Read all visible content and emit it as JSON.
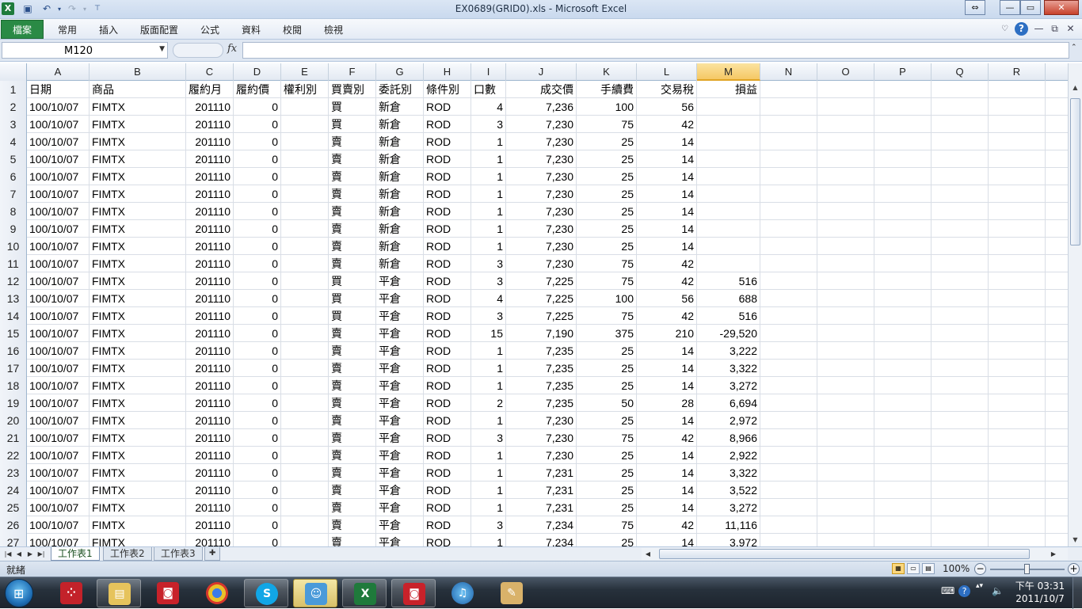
{
  "window": {
    "title": "EX0689(GRID0).xls - Microsoft Excel",
    "app_icon": "X"
  },
  "ribbon": {
    "file_tab": "檔案",
    "tabs": [
      "常用",
      "插入",
      "版面配置",
      "公式",
      "資料",
      "校閱",
      "檢視"
    ]
  },
  "formula_bar": {
    "name_box": "M120",
    "fx": "fx",
    "formula": ""
  },
  "columns": [
    "A",
    "B",
    "C",
    "D",
    "E",
    "F",
    "G",
    "H",
    "I",
    "J",
    "K",
    "L",
    "M",
    "N",
    "O",
    "P",
    "Q",
    "R"
  ],
  "selected_column": "M",
  "header_row": [
    "日期",
    "商品",
    "履約月",
    "履約價",
    "權利別",
    "買賣別",
    "委託別",
    "條件別",
    "口數",
    "成交價",
    "手續費",
    "交易稅",
    "損益"
  ],
  "rows": [
    [
      "2",
      "100/10/07",
      "FIMTX",
      "201110",
      "0",
      "",
      "買",
      "新倉",
      "ROD",
      "4",
      "7,236",
      "100",
      "56",
      ""
    ],
    [
      "3",
      "100/10/07",
      "FIMTX",
      "201110",
      "0",
      "",
      "買",
      "新倉",
      "ROD",
      "3",
      "7,230",
      "75",
      "42",
      ""
    ],
    [
      "4",
      "100/10/07",
      "FIMTX",
      "201110",
      "0",
      "",
      "賣",
      "新倉",
      "ROD",
      "1",
      "7,230",
      "25",
      "14",
      ""
    ],
    [
      "5",
      "100/10/07",
      "FIMTX",
      "201110",
      "0",
      "",
      "賣",
      "新倉",
      "ROD",
      "1",
      "7,230",
      "25",
      "14",
      ""
    ],
    [
      "6",
      "100/10/07",
      "FIMTX",
      "201110",
      "0",
      "",
      "賣",
      "新倉",
      "ROD",
      "1",
      "7,230",
      "25",
      "14",
      ""
    ],
    [
      "7",
      "100/10/07",
      "FIMTX",
      "201110",
      "0",
      "",
      "賣",
      "新倉",
      "ROD",
      "1",
      "7,230",
      "25",
      "14",
      ""
    ],
    [
      "8",
      "100/10/07",
      "FIMTX",
      "201110",
      "0",
      "",
      "賣",
      "新倉",
      "ROD",
      "1",
      "7,230",
      "25",
      "14",
      ""
    ],
    [
      "9",
      "100/10/07",
      "FIMTX",
      "201110",
      "0",
      "",
      "賣",
      "新倉",
      "ROD",
      "1",
      "7,230",
      "25",
      "14",
      ""
    ],
    [
      "10",
      "100/10/07",
      "FIMTX",
      "201110",
      "0",
      "",
      "賣",
      "新倉",
      "ROD",
      "1",
      "7,230",
      "25",
      "14",
      ""
    ],
    [
      "11",
      "100/10/07",
      "FIMTX",
      "201110",
      "0",
      "",
      "賣",
      "新倉",
      "ROD",
      "3",
      "7,230",
      "75",
      "42",
      ""
    ],
    [
      "12",
      "100/10/07",
      "FIMTX",
      "201110",
      "0",
      "",
      "買",
      "平倉",
      "ROD",
      "3",
      "7,225",
      "75",
      "42",
      "516"
    ],
    [
      "13",
      "100/10/07",
      "FIMTX",
      "201110",
      "0",
      "",
      "買",
      "平倉",
      "ROD",
      "4",
      "7,225",
      "100",
      "56",
      "688"
    ],
    [
      "14",
      "100/10/07",
      "FIMTX",
      "201110",
      "0",
      "",
      "買",
      "平倉",
      "ROD",
      "3",
      "7,225",
      "75",
      "42",
      "516"
    ],
    [
      "15",
      "100/10/07",
      "FIMTX",
      "201110",
      "0",
      "",
      "賣",
      "平倉",
      "ROD",
      "15",
      "7,190",
      "375",
      "210",
      "-29,520"
    ],
    [
      "16",
      "100/10/07",
      "FIMTX",
      "201110",
      "0",
      "",
      "賣",
      "平倉",
      "ROD",
      "1",
      "7,235",
      "25",
      "14",
      "3,222"
    ],
    [
      "17",
      "100/10/07",
      "FIMTX",
      "201110",
      "0",
      "",
      "賣",
      "平倉",
      "ROD",
      "1",
      "7,235",
      "25",
      "14",
      "3,322"
    ],
    [
      "18",
      "100/10/07",
      "FIMTX",
      "201110",
      "0",
      "",
      "賣",
      "平倉",
      "ROD",
      "1",
      "7,235",
      "25",
      "14",
      "3,272"
    ],
    [
      "19",
      "100/10/07",
      "FIMTX",
      "201110",
      "0",
      "",
      "賣",
      "平倉",
      "ROD",
      "2",
      "7,235",
      "50",
      "28",
      "6,694"
    ],
    [
      "20",
      "100/10/07",
      "FIMTX",
      "201110",
      "0",
      "",
      "賣",
      "平倉",
      "ROD",
      "1",
      "7,230",
      "25",
      "14",
      "2,972"
    ],
    [
      "21",
      "100/10/07",
      "FIMTX",
      "201110",
      "0",
      "",
      "賣",
      "平倉",
      "ROD",
      "3",
      "7,230",
      "75",
      "42",
      "8,966"
    ],
    [
      "22",
      "100/10/07",
      "FIMTX",
      "201110",
      "0",
      "",
      "賣",
      "平倉",
      "ROD",
      "1",
      "7,230",
      "25",
      "14",
      "2,922"
    ],
    [
      "23",
      "100/10/07",
      "FIMTX",
      "201110",
      "0",
      "",
      "賣",
      "平倉",
      "ROD",
      "1",
      "7,231",
      "25",
      "14",
      "3,322"
    ],
    [
      "24",
      "100/10/07",
      "FIMTX",
      "201110",
      "0",
      "",
      "賣",
      "平倉",
      "ROD",
      "1",
      "7,231",
      "25",
      "14",
      "3,522"
    ],
    [
      "25",
      "100/10/07",
      "FIMTX",
      "201110",
      "0",
      "",
      "賣",
      "平倉",
      "ROD",
      "1",
      "7,231",
      "25",
      "14",
      "3,272"
    ],
    [
      "26",
      "100/10/07",
      "FIMTX",
      "201110",
      "0",
      "",
      "賣",
      "平倉",
      "ROD",
      "3",
      "7,234",
      "75",
      "42",
      "11,116"
    ],
    [
      "27",
      "100/10/07",
      "FIMTX",
      "201110",
      "0",
      "",
      "賣",
      "平倉",
      "ROD",
      "1",
      "7,234",
      "25",
      "14",
      "3,972"
    ]
  ],
  "sheets": [
    "工作表1",
    "工作表2",
    "工作表3"
  ],
  "active_sheet": "工作表1",
  "status": {
    "ready": "就緒",
    "zoom": "100%"
  },
  "taskbar": {
    "clock_time": "下午 03:31",
    "clock_date": "2011/10/7"
  },
  "colors": {
    "excel_green": "#2a8a45",
    "selected_header": "#f5c865"
  }
}
